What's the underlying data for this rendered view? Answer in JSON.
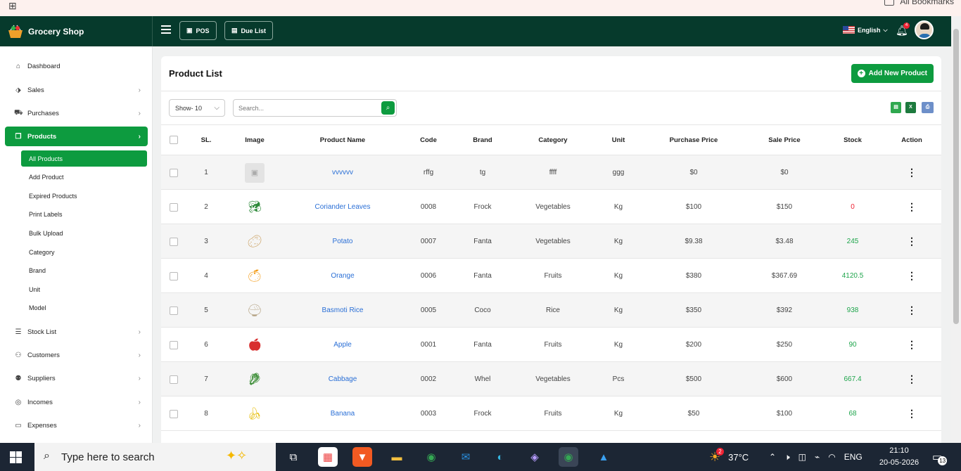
{
  "bookmarks": {
    "apps_icon": "apps-grid-icon",
    "all_bookmarks": "All Bookmarks"
  },
  "brand": {
    "name": "Grocery Shop",
    "logo": "basket-icon"
  },
  "topbar": {
    "pos_label": "POS",
    "due_list_label": "Due List",
    "language": "English",
    "notification_count": "4"
  },
  "sidebar": {
    "items": [
      {
        "label": "Dashboard",
        "icon": "home-icon"
      },
      {
        "label": "Sales",
        "icon": "tag-icon"
      },
      {
        "label": "Purchases",
        "icon": "cart-icon"
      },
      {
        "label": "Products",
        "icon": "cube-icon"
      },
      {
        "label": "Stock List",
        "icon": "list-icon"
      },
      {
        "label": "Customers",
        "icon": "users-icon"
      },
      {
        "label": "Suppliers",
        "icon": "user-group-icon"
      },
      {
        "label": "Incomes",
        "icon": "coin-icon"
      },
      {
        "label": "Expenses",
        "icon": "wallet-icon"
      }
    ],
    "sub_items": [
      "All Products",
      "Add Product",
      "Expired Products",
      "Print Labels",
      "Bulk Upload",
      "Category",
      "Brand",
      "Unit",
      "Model"
    ]
  },
  "page": {
    "title": "Product List",
    "add_button": "Add New Product",
    "show_select": "Show- 10",
    "search_placeholder": "Search..."
  },
  "table": {
    "headers": [
      "SL.",
      "Image",
      "Product Name",
      "Code",
      "Brand",
      "Category",
      "Unit",
      "Purchase Price",
      "Sale Price",
      "Stock",
      "Action"
    ],
    "rows": [
      {
        "sl": "1",
        "name": "vvvvvv",
        "code": "rffg",
        "brand": "tg",
        "category": "ffff",
        "unit": "ggg",
        "purchase": "$0",
        "sale": "$0",
        "stock": "",
        "img": "placeholder-image"
      },
      {
        "sl": "2",
        "name": "Coriander Leaves",
        "code": "0008",
        "brand": "Frock",
        "category": "Vegetables",
        "unit": "Kg",
        "purchase": "$100",
        "sale": "$150",
        "stock": "0",
        "img": "coriander-image"
      },
      {
        "sl": "3",
        "name": "Potato",
        "code": "0007",
        "brand": "Fanta",
        "category": "Vegetables",
        "unit": "Kg",
        "purchase": "$9.38",
        "sale": "$3.48",
        "stock": "245",
        "img": "potato-image"
      },
      {
        "sl": "4",
        "name": "Orange",
        "code": "0006",
        "brand": "Fanta",
        "category": "Fruits",
        "unit": "Kg",
        "purchase": "$380",
        "sale": "$367.69",
        "stock": "4120.5",
        "img": "orange-image"
      },
      {
        "sl": "5",
        "name": "Basmoti Rice",
        "code": "0005",
        "brand": "Coco",
        "category": "Rice",
        "unit": "Kg",
        "purchase": "$350",
        "sale": "$392",
        "stock": "938",
        "img": "rice-image"
      },
      {
        "sl": "6",
        "name": "Apple",
        "code": "0001",
        "brand": "Fanta",
        "category": "Fruits",
        "unit": "Kg",
        "purchase": "$200",
        "sale": "$250",
        "stock": "90",
        "img": "apple-image"
      },
      {
        "sl": "7",
        "name": "Cabbage",
        "code": "0002",
        "brand": "Whel",
        "category": "Vegetables",
        "unit": "Pcs",
        "purchase": "$500",
        "sale": "$600",
        "stock": "667.4",
        "img": "cabbage-image"
      },
      {
        "sl": "8",
        "name": "Banana",
        "code": "0003",
        "brand": "Frock",
        "category": "Fruits",
        "unit": "Kg",
        "purchase": "$50",
        "sale": "$100",
        "stock": "68",
        "img": "banana-image"
      }
    ]
  },
  "colors": {
    "brand_dark": "#063a2c",
    "accent": "#0d9b3f",
    "link": "#2a6fd6",
    "stock_low": "#e23",
    "stock_ok": "#1fa54c"
  },
  "taskbar": {
    "search_placeholder": "Type here to search",
    "temperature": "37°C",
    "lang": "ENG",
    "time": "21:10",
    "date": "20-05-2026",
    "weather_badge": "2",
    "notif_count": "13"
  }
}
